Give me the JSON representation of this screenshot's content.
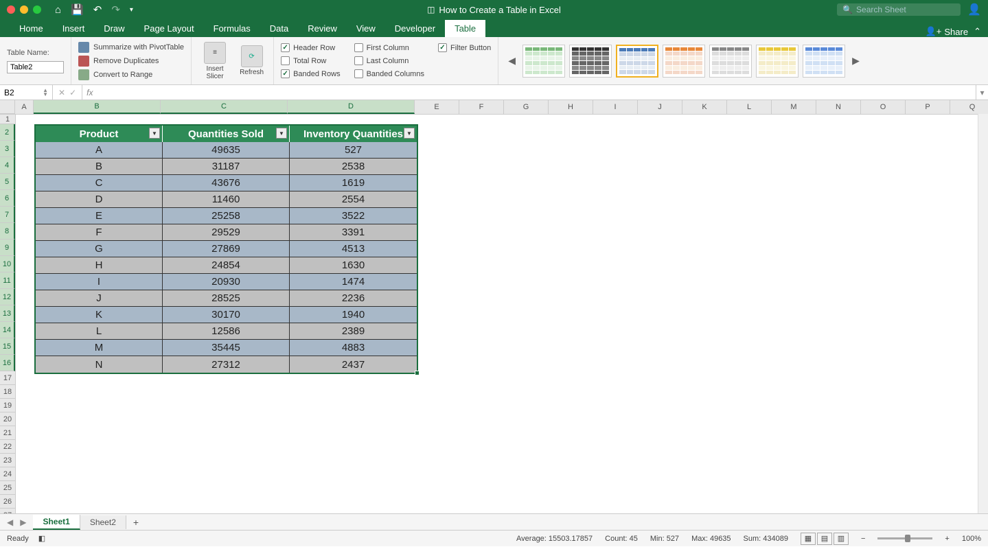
{
  "titlebar": {
    "doc_title": "How to Create a Table in Excel",
    "search_placeholder": "Search Sheet"
  },
  "tabs": {
    "items": [
      "Home",
      "Insert",
      "Draw",
      "Page Layout",
      "Formulas",
      "Data",
      "Review",
      "View",
      "Developer",
      "Table"
    ],
    "active": "Table",
    "share": "Share"
  },
  "ribbon": {
    "table_name_label": "Table Name:",
    "table_name_value": "Table2",
    "tools": {
      "pivot": "Summarize with PivotTable",
      "dupes": "Remove Duplicates",
      "range": "Convert to Range",
      "slicer": "Insert Slicer",
      "refresh": "Refresh"
    },
    "options": {
      "header_row": "Header Row",
      "total_row": "Total Row",
      "banded_rows": "Banded Rows",
      "first_col": "First Column",
      "last_col": "Last Column",
      "banded_cols": "Banded Columns",
      "filter_btn": "Filter Button"
    }
  },
  "formula_bar": {
    "name_box": "B2",
    "fx": "fx"
  },
  "columns": [
    "A",
    "B",
    "C",
    "D",
    "E",
    "F",
    "G",
    "H",
    "I",
    "J",
    "K",
    "L",
    "M",
    "N",
    "O",
    "P",
    "Q"
  ],
  "table": {
    "headers": [
      "Product",
      "Quantities Sold",
      "Inventory Quantities"
    ],
    "rows": [
      {
        "p": "A",
        "q": "49635",
        "i": "527"
      },
      {
        "p": "B",
        "q": "31187",
        "i": "2538"
      },
      {
        "p": "C",
        "q": "43676",
        "i": "1619"
      },
      {
        "p": "D",
        "q": "11460",
        "i": "2554"
      },
      {
        "p": "E",
        "q": "25258",
        "i": "3522"
      },
      {
        "p": "F",
        "q": "29529",
        "i": "3391"
      },
      {
        "p": "G",
        "q": "27869",
        "i": "4513"
      },
      {
        "p": "H",
        "q": "24854",
        "i": "1630"
      },
      {
        "p": "I",
        "q": "20930",
        "i": "1474"
      },
      {
        "p": "J",
        "q": "28525",
        "i": "2236"
      },
      {
        "p": "K",
        "q": "30170",
        "i": "1940"
      },
      {
        "p": "L",
        "q": "12586",
        "i": "2389"
      },
      {
        "p": "M",
        "q": "35445",
        "i": "4883"
      },
      {
        "p": "N",
        "q": "27312",
        "i": "2437"
      }
    ]
  },
  "sheets": {
    "tabs": [
      "Sheet1",
      "Sheet2"
    ],
    "active": "Sheet1"
  },
  "status": {
    "ready": "Ready",
    "avg": "Average: 15503.17857",
    "count": "Count: 45",
    "min": "Min: 527",
    "max": "Max: 49635",
    "sum": "Sum: 434089",
    "zoom": "100%"
  }
}
